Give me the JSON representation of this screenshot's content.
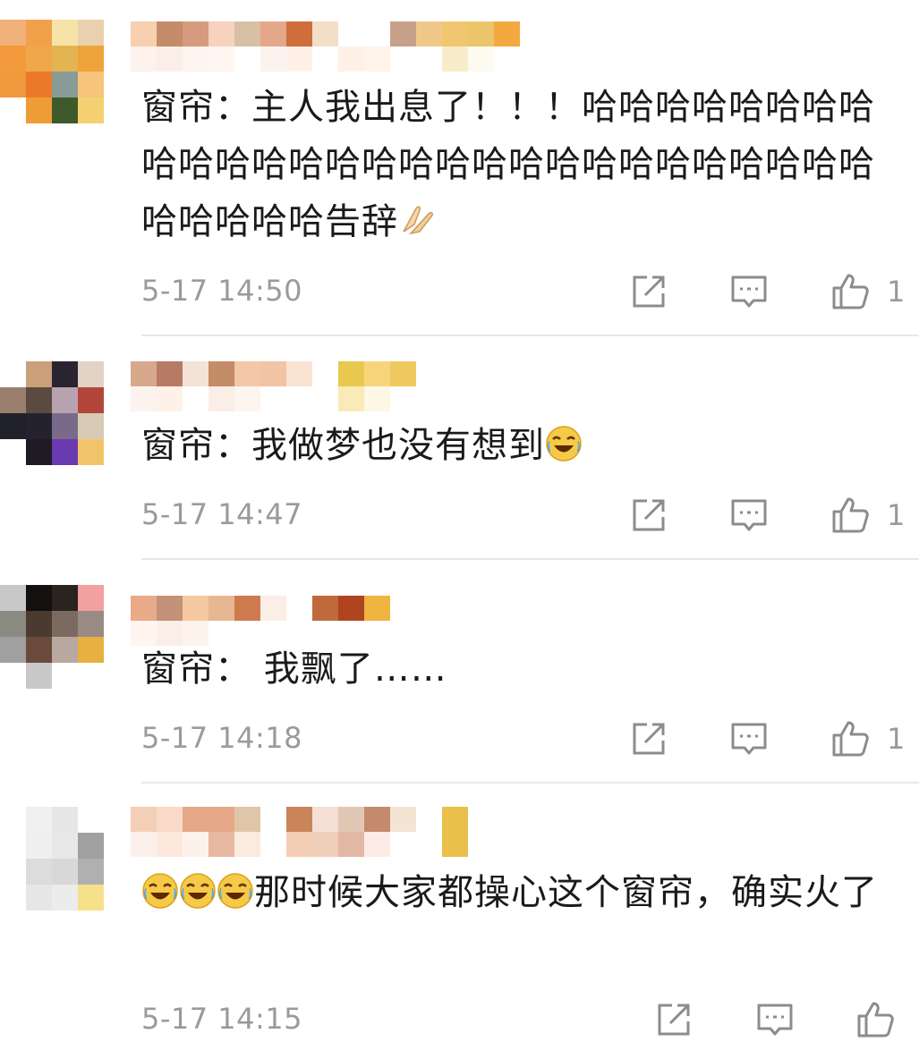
{
  "comments": [
    {
      "text_parts": [
        "窗帘：主人我出息了！！！哈哈哈哈哈哈哈哈哈哈哈哈哈哈哈哈哈哈哈哈哈哈哈哈哈哈哈哈哈哈哈哈哈告辞"
      ],
      "trailing_emoji": "folded-hands-emoji",
      "time": "5-17 14:50",
      "likes": "1"
    },
    {
      "text_parts": [
        "窗帘：我做梦也没有想到"
      ],
      "trailing_emoji": "crying-laughing-emoji",
      "time": "5-17 14:47",
      "likes": "1"
    },
    {
      "text_parts": [
        "窗帘： 我飘了……"
      ],
      "time": "5-17 14:18",
      "likes": "1"
    },
    {
      "leading_emojis": [
        "crying-laughing-emoji",
        "crying-laughing-emoji",
        "crying-laughing-emoji"
      ],
      "text_parts": [
        "那时候大家都操心这个窗帘，确实火了"
      ],
      "time": "5-17 14:15",
      "likes": ""
    }
  ],
  "icons": {
    "share": "share-icon",
    "comment": "comment-icon",
    "like": "like-icon"
  },
  "colors": {
    "text": "#1a1a1a",
    "meta": "#9a9a9a",
    "divider": "#e8e8e8"
  }
}
